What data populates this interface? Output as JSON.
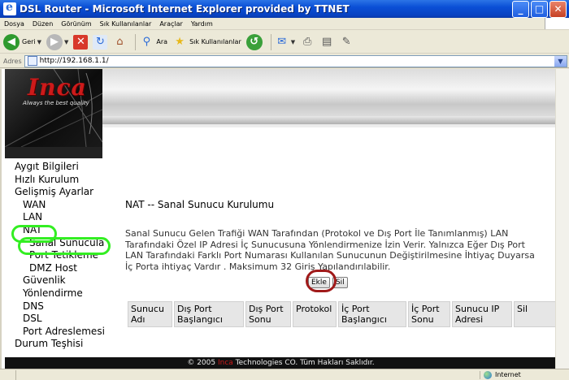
{
  "window": {
    "title": "DSL Router - Microsoft Internet Explorer provided by TTNET"
  },
  "menu": [
    "Dosya",
    "Düzen",
    "Görünüm",
    "Sık Kullanılanlar",
    "Araçlar",
    "Yardım"
  ],
  "toolbar": {
    "back": "Geri",
    "search": "Ara",
    "favorites": "Sık Kullanılanlar"
  },
  "address": {
    "label": "Adres",
    "url": "http://192.168.1.1/"
  },
  "brand": {
    "name": "Inca",
    "tagline": "Always the best quality"
  },
  "sidebar": [
    {
      "label": "Aygıt Bilgileri",
      "level": 0
    },
    {
      "label": "Hızlı Kurulum",
      "level": 0
    },
    {
      "label": "Gelişmiş Ayarlar",
      "level": 0
    },
    {
      "label": "WAN",
      "level": 1
    },
    {
      "label": "LAN",
      "level": 1
    },
    {
      "label": "NAT",
      "level": 1
    },
    {
      "label": "Sanal Sunucula",
      "level": 2
    },
    {
      "label": "Port Tetikleme",
      "level": 2
    },
    {
      "label": "DMZ Host",
      "level": 2
    },
    {
      "label": "Güvenlik",
      "level": 1
    },
    {
      "label": "Yönlendirme",
      "level": 1
    },
    {
      "label": "DNS",
      "level": 1
    },
    {
      "label": "DSL",
      "level": 1
    },
    {
      "label": "Port Adreslemesi",
      "level": 1
    },
    {
      "label": "Durum Teşhisi",
      "level": 0
    }
  ],
  "page": {
    "title": "NAT -- Sanal Sunucu Kurulumu",
    "description": "Sanal Sunucu Gelen Trafiği WAN Tarafından (Protokol ve Dış Port İle Tanımlanmış) LAN Tarafındaki Özel IP Adresi İç Sunucusuna Yönlendirmenize İzin Verir. Yalnızca Eğer Dış Port LAN Tarafındaki Farklı Port Numarası Kullanılan Sunucunun Değiştirilmesine İhtiyaç Duyarsa İç Porta ihtiyaç Vardır . Maksimum 32 Giriş Yapılandırılabilir.",
    "add_button": "Ekle",
    "delete_button": "Sil",
    "columns": [
      "Sunucu Adı",
      "Dış Port Başlangıcı",
      "Dış Port Sonu",
      "Protokol",
      "İç Port Başlangıcı",
      "İç Port Sonu",
      "Sunucu IP Adresi",
      "Sil"
    ]
  },
  "footer": {
    "prefix": "© 2005 ",
    "brand": "Inca",
    "suffix": " Technologies CO. Tüm Hakları Saklıdır."
  },
  "status": {
    "zone": "Internet"
  }
}
